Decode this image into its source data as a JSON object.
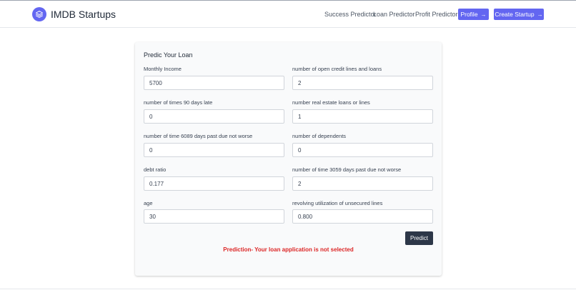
{
  "header": {
    "brand": "IMDB Startups",
    "logo_icon": "layers-icon",
    "nav": {
      "success": "Success Predictor",
      "loan": "Loan Predictor",
      "profit": "Profit Predictor"
    },
    "profile_button": "Profile",
    "create_button": "Create Startup",
    "arrow": "→"
  },
  "form": {
    "title": "Predic Your Loan",
    "fields": [
      {
        "label": "Monthly Income",
        "value": "5700"
      },
      {
        "label": "number of open credit lines and loans",
        "value": "2"
      },
      {
        "label": "number of times 90 days late",
        "value": "0"
      },
      {
        "label": "number real estate loans or lines",
        "value": "1"
      },
      {
        "label": "number of time 6089 days past due not worse",
        "value": "0"
      },
      {
        "label": "number of dependents",
        "value": "0"
      },
      {
        "label": "debt ratio",
        "value": "0.177"
      },
      {
        "label": "number of time 3059 days past due not worse",
        "value": "2"
      },
      {
        "label": "age",
        "value": "30"
      },
      {
        "label": "revolving utilization of unsecured lines",
        "value": "0.800"
      }
    ],
    "predict_button": "Predict",
    "result": "Prediction- Your loan application is not selected"
  },
  "colors": {
    "accent": "#6366f1",
    "dark_button": "#2d3748",
    "error": "#dc2626"
  }
}
